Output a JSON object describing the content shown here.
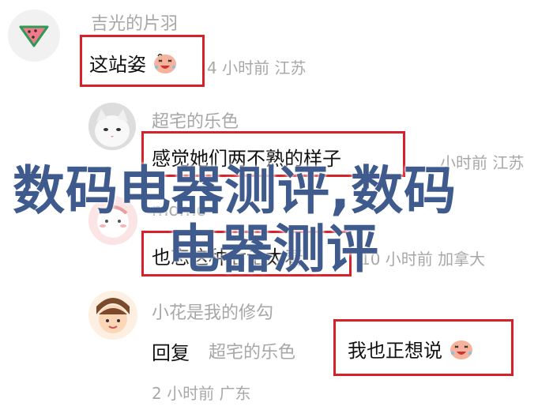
{
  "comments": [
    {
      "username": "吉光的片羽",
      "text": "这站姿",
      "meta_time": "4 小时前",
      "meta_location": "江苏",
      "avatar_icon": "watermelon-icon",
      "emoji_icon": "laughing-face-emoji"
    },
    {
      "username": "超宅的乐色",
      "text": "感觉她们两不熟的样子",
      "meta_time": "小时前",
      "meta_location": "江苏",
      "avatar_icon": "cat-photo"
    },
    {
      "username": "momo",
      "text": "也忘这种后话太着",
      "meta_time": "10 小时前",
      "meta_location": "加拿大",
      "avatar_icon": "cartoon-girl-avatar"
    },
    {
      "username": "小花是我的修勾",
      "reply_word": "回复",
      "reply_target": "超宅的乐色",
      "text": "我也正想说",
      "meta_time": "2 小时前",
      "meta_location": "广东",
      "avatar_icon": "cartoon-face-avatar",
      "emoji_icon": "laughing-face-emoji"
    }
  ],
  "overlay": {
    "line1": "数码电器测评,数码",
    "line2": "电器测评"
  },
  "colors": {
    "highlight_border": "#d8202a",
    "overlay_text": "#3f5a8c",
    "secondary_text": "#a8a8a8"
  }
}
